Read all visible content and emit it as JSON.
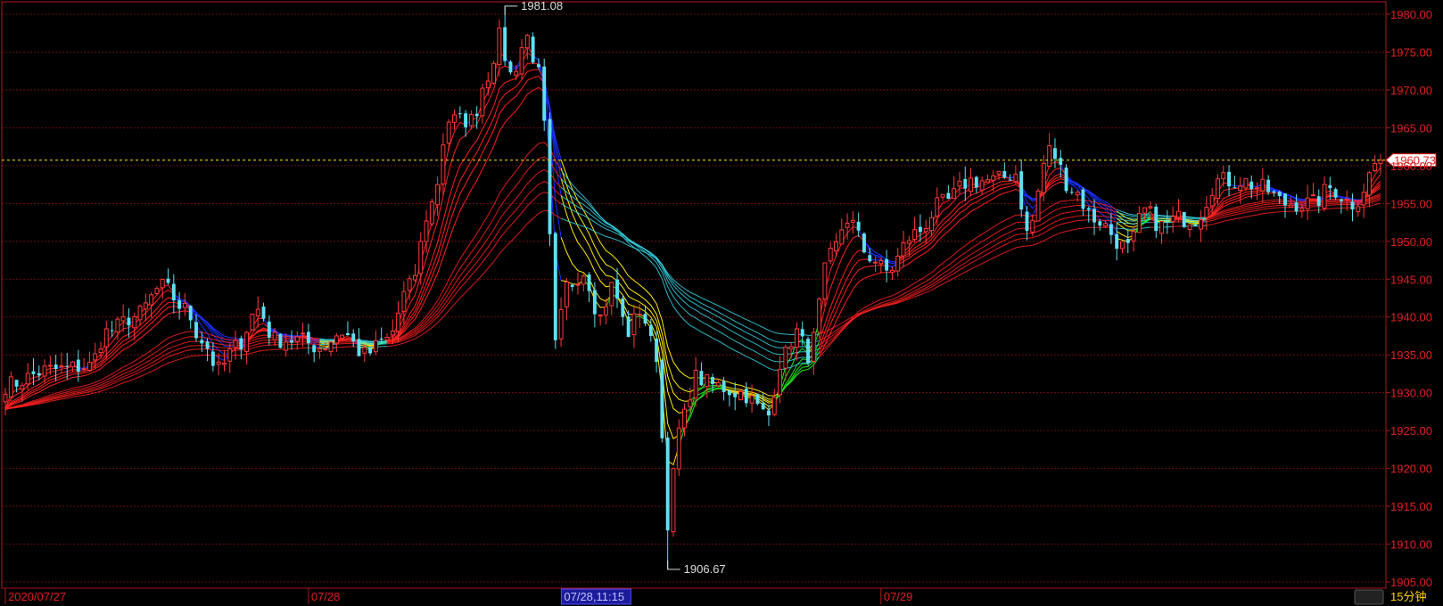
{
  "colors": {
    "background": "#000000",
    "frame": "#b01818",
    "grid": "#8a1010",
    "axis_text": "#e02020",
    "up_candle": "#ff3a3a",
    "down_candle": "#5fe0f2",
    "price_line": "#e8d000",
    "annotation": "#dddddd",
    "ribbon_red": "#ff2020",
    "ribbon_blue": "#1a30ff",
    "ribbon_yellow": "#ffea00",
    "ribbon_green": "#19e619",
    "ribbon_cyan": "#35d6e8",
    "cursor_bg": "#1c1c9a",
    "cursor_text": "#c0c0ff",
    "period_text": "#ffd400"
  },
  "chart_data": {
    "type": "candlestick",
    "ylim": [
      1905,
      1981
    ],
    "y_ticks": [
      "1905.00",
      "1910.00",
      "1915.00",
      "1920.00",
      "1925.00",
      "1930.00",
      "1935.00",
      "1940.00",
      "1945.00",
      "1950.00",
      "1955.00",
      "1960.00",
      "1965.00",
      "1970.00",
      "1975.00",
      "1980.00"
    ],
    "x_labels": [
      {
        "label": "2020/07/27",
        "index": 0
      },
      {
        "label": "07/28",
        "index": 54
      },
      {
        "label": "07/29",
        "index": 156
      }
    ],
    "cursor_label": {
      "label": "07/28,11:15",
      "index": 100
    },
    "period_label": "15分钟",
    "last_price": {
      "label": "1960.73",
      "value": 1960.73
    },
    "high_marker": {
      "label": "1981.08",
      "value": 1981.08,
      "index": 89
    },
    "low_marker": {
      "label": "1906.67",
      "value": 1906.67,
      "index": 118
    },
    "bar_count": 246,
    "anchors": [
      [
        0,
        1931
      ],
      [
        8,
        1933
      ],
      [
        15,
        1933.5
      ],
      [
        18,
        1938
      ],
      [
        23,
        1940
      ],
      [
        28,
        1944
      ],
      [
        32,
        1941
      ],
      [
        35,
        1937
      ],
      [
        38,
        1933
      ],
      [
        41,
        1936
      ],
      [
        45,
        1941
      ],
      [
        48,
        1937
      ],
      [
        52,
        1937
      ],
      [
        56,
        1936
      ],
      [
        60,
        1938
      ],
      [
        64,
        1935
      ],
      [
        68,
        1937
      ],
      [
        72,
        1944
      ],
      [
        76,
        1955
      ],
      [
        79,
        1966
      ],
      [
        83,
        1966
      ],
      [
        86,
        1972
      ],
      [
        88,
        1977
      ],
      [
        90,
        1972
      ],
      [
        93,
        1977
      ],
      [
        95,
        1972
      ],
      [
        96,
        1965
      ],
      [
        97,
        1950
      ],
      [
        98,
        1936
      ],
      [
        100,
        1944
      ],
      [
        103,
        1946
      ],
      [
        106,
        1940
      ],
      [
        108,
        1944
      ],
      [
        111,
        1938
      ],
      [
        113,
        1941
      ],
      [
        116,
        1935
      ],
      [
        118,
        1913
      ],
      [
        120,
        1925
      ],
      [
        123,
        1932
      ],
      [
        126,
        1931
      ],
      [
        131,
        1930
      ],
      [
        136,
        1927
      ],
      [
        138,
        1934
      ],
      [
        141,
        1938
      ],
      [
        143,
        1935
      ],
      [
        147,
        1948
      ],
      [
        150,
        1953
      ],
      [
        154,
        1948
      ],
      [
        157,
        1946
      ],
      [
        162,
        1951
      ],
      [
        167,
        1955
      ],
      [
        172,
        1958
      ],
      [
        176,
        1958
      ],
      [
        180,
        1959
      ],
      [
        182,
        1951
      ],
      [
        186,
        1962
      ],
      [
        190,
        1957
      ],
      [
        194,
        1953
      ],
      [
        200,
        1949
      ],
      [
        203,
        1954
      ],
      [
        206,
        1952
      ],
      [
        209,
        1953
      ],
      [
        212,
        1953
      ],
      [
        216,
        1958
      ],
      [
        220,
        1958
      ],
      [
        224,
        1957
      ],
      [
        228,
        1955
      ],
      [
        233,
        1955
      ],
      [
        236,
        1957
      ],
      [
        240,
        1955
      ],
      [
        245,
        1960.73
      ]
    ]
  }
}
